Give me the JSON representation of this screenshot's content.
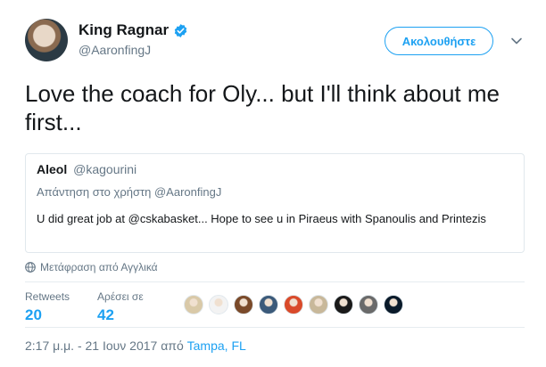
{
  "author": {
    "display_name": "King Ragnar",
    "handle": "@AaronfingJ"
  },
  "follow_button_label": "Ακολουθήστε",
  "tweet": {
    "text": "Love the coach for Oly... but I'll think about me first..."
  },
  "quoted_tweet": {
    "author_name": "Aleol",
    "author_handle": "@kagourini",
    "reply_context": "Απάντηση στο χρήστη @AaronfingJ",
    "text": "U did great job at @cskabasket... Hope to see u in Piraeus with Spanoulis and Printezis"
  },
  "translate_label": "Μετάφραση από Αγγλικά",
  "stats": {
    "retweets_label": "Retweets",
    "retweets_count": "20",
    "likes_label": "Αρέσει σε",
    "likes_count": "42"
  },
  "likers": [
    {
      "icon": "avatar",
      "color": "#d9c9a8"
    },
    {
      "icon": "avatar",
      "color": "#f3f3f3"
    },
    {
      "icon": "avatar",
      "color": "#7a4a2a"
    },
    {
      "icon": "avatar",
      "color": "#3b5a7a"
    },
    {
      "icon": "avatar",
      "color": "#d94a2a"
    },
    {
      "icon": "avatar",
      "color": "#c8b89a"
    },
    {
      "icon": "avatar",
      "color": "#1a1a1a"
    },
    {
      "icon": "avatar",
      "color": "#6a6a6a"
    },
    {
      "icon": "avatar",
      "color": "#0a1a2a"
    }
  ],
  "timestamp": {
    "time_date": "2:17 μ.μ. - 21 Ιουν 2017 από",
    "place": "Tampa, FL"
  },
  "colors": {
    "accent": "#1da1f2",
    "muted": "#657786",
    "border": "#e1e8ed"
  }
}
